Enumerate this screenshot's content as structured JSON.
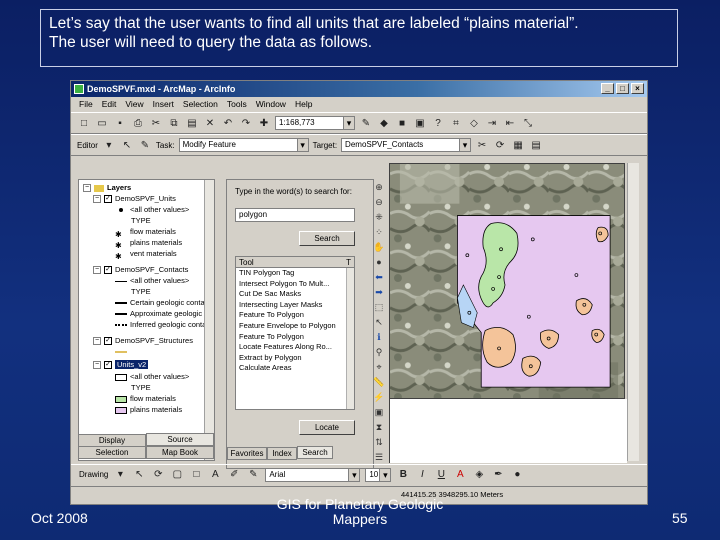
{
  "caption": {
    "line1": "Let’s say that the user wants to find all units that are labeled “plains material”.",
    "line2": "The user will need to query the data as follows."
  },
  "footer": {
    "date": "Oct 2008",
    "center_line1": "GIS for Planetary Geologic",
    "center_line2": "Mappers",
    "page": "55"
  },
  "window": {
    "title": "DemoSPVF.mxd - ArcMap - ArcInfo",
    "controls": [
      "_",
      "□",
      "×"
    ]
  },
  "menu": [
    "File",
    "Edit",
    "View",
    "Insert",
    "Selection",
    "Tools",
    "Window",
    "Help"
  ],
  "standard_toolbar": {
    "scale": "1:168,773"
  },
  "editor_toolbar": {
    "editor_label": "Editor",
    "task_label": "Task:",
    "task_value": "Modify Feature",
    "target_label": "Target:",
    "target_value": "DemoSPVF_Contacts"
  },
  "toc": {
    "items": [
      {
        "label": "Layers",
        "level": 0,
        "type": "group"
      },
      {
        "label": "DemoSPVF_Units",
        "level": 1,
        "type": "layer"
      },
      {
        "label": "<all other values>",
        "level": 2,
        "type": "legend",
        "color": "#000000"
      },
      {
        "label": "TYPE",
        "level": 2,
        "type": "heading"
      },
      {
        "label": "flow materials",
        "level": 2,
        "type": "legend",
        "color": "#000000"
      },
      {
        "label": "plains materials",
        "level": 2,
        "type": "legend",
        "color": "#000000"
      },
      {
        "label": "vent materials",
        "level": 2,
        "type": "legend",
        "color": "#000000"
      },
      {
        "label": "DemoSPVF_Contacts",
        "level": 1,
        "type": "layer"
      },
      {
        "label": "<all other values>",
        "level": 2,
        "type": "legend",
        "color": "#000000"
      },
      {
        "label": "TYPE",
        "level": 2,
        "type": "heading"
      },
      {
        "label": "Certain geologic contact",
        "level": 2,
        "type": "legend",
        "color": "#000000"
      },
      {
        "label": "Approximate geologic contact",
        "level": 2,
        "type": "legend",
        "color": "#000000"
      },
      {
        "label": "Inferred geologic contact",
        "level": 2,
        "type": "legend",
        "color": "#000000"
      },
      {
        "label": "DemoSPVF_Structures",
        "level": 1,
        "type": "layer"
      },
      {
        "label": "",
        "level": 2,
        "type": "legend",
        "color": "#e0c060"
      },
      {
        "label": "Units_v2",
        "level": 1,
        "type": "layer-selected"
      },
      {
        "label": "<all other values>",
        "level": 2,
        "type": "legend",
        "color": "#ffffff"
      },
      {
        "label": "TYPE",
        "level": 2,
        "type": "heading"
      },
      {
        "label": "flow materials",
        "level": 2,
        "type": "legend",
        "color": "#b9e6a8"
      },
      {
        "label": "plains materials",
        "level": 2,
        "type": "legend",
        "color": "#e6c8f0"
      }
    ],
    "tabs": [
      "Display",
      "Source",
      "Selection",
      "Map Book"
    ]
  },
  "search": {
    "prompt": "Type in the word(s) to search for:",
    "query": "polygon",
    "search_button": "Search",
    "results_header": "Tool",
    "results_header_col2": "T",
    "results": [
      "TIN Polygon Tag",
      "Intersect Polygon To Mult...",
      "Cut De Sac Masks",
      "Intersecting Layer Masks",
      "Feature To Polygon",
      "Feature Envelope to Polygon",
      "Feature To Polygon",
      "Locate Features Along Ro...",
      "Extract by Polygon",
      "Calculate Areas"
    ],
    "locate_button": "Locate",
    "tabs": [
      "Favorites",
      "Index",
      "Search"
    ]
  },
  "drawing_toolbar": {
    "drawing_label": "Drawing",
    "font": "Arial",
    "font_size": "10"
  },
  "status": {
    "coordinates": "441415.25  3948295.10 Meters"
  },
  "colors": {
    "slide_bg": "#0e2a73",
    "plains": "#e6c8f0",
    "flow": "#b9e6a8",
    "vent": "#f4c49a",
    "selection_blue": "#b7d5f5"
  }
}
